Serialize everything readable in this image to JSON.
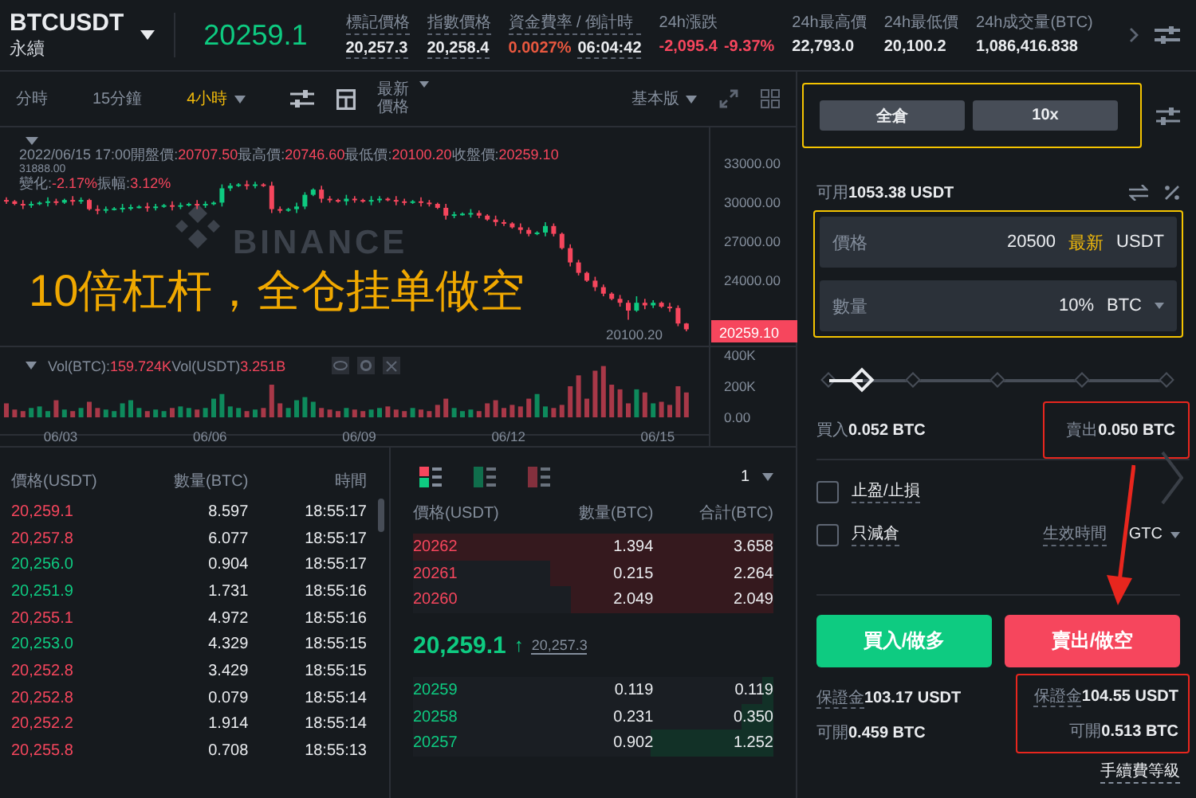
{
  "header": {
    "symbol": "BTCUSDT",
    "contract": "永續",
    "last_price": "20259.1",
    "stats": [
      {
        "label": "標記價格",
        "underlined": true,
        "values": [
          {
            "text": "20,257.3",
            "kind": "plain"
          }
        ]
      },
      {
        "label": "指數價格",
        "underlined": true,
        "values": [
          {
            "text": "20,258.4",
            "kind": "plain"
          }
        ]
      },
      {
        "label": "資金費率 / 倒計時",
        "underlined": true,
        "values": [
          {
            "text": "0.0027%",
            "kind": "rate"
          },
          {
            "text": "06:04:42",
            "kind": "plain"
          }
        ]
      },
      {
        "label": "24h漲跌",
        "underlined": false,
        "values": [
          {
            "text": "-2,095.4",
            "kind": "down"
          },
          {
            "text": "-9.37%",
            "kind": "down"
          }
        ]
      },
      {
        "label": "24h最高價",
        "underlined": false,
        "values": [
          {
            "text": "22,793.0",
            "kind": "plain"
          }
        ]
      },
      {
        "label": "24h最低價",
        "underlined": false,
        "values": [
          {
            "text": "20,100.2",
            "kind": "plain"
          }
        ]
      },
      {
        "label": "24h成交量(BTC)",
        "underlined": false,
        "values": [
          {
            "text": "1,086,416.838",
            "kind": "plain"
          }
        ]
      }
    ]
  },
  "toolbar": {
    "intervals": [
      {
        "label": "分時",
        "selected": false,
        "dropdown": false
      },
      {
        "label": "15分鐘",
        "selected": false,
        "dropdown": false
      },
      {
        "label": "4小時",
        "selected": true,
        "dropdown": true
      }
    ],
    "price_type": "最新價格",
    "view": "基本版"
  },
  "chart": {
    "logo_text": "BINANCE",
    "info_date": "2022/06/15 17:00",
    "info_line1": [
      {
        "label": "開盤價:",
        "value": "20707.50"
      },
      {
        "label": "最高價:",
        "value": "20746.60"
      },
      {
        "label": "最低價:",
        "value": "20100.20"
      },
      {
        "label": "收盤價:",
        "value": "20259.10"
      }
    ],
    "info_line2": [
      {
        "label": "變化:",
        "value": "-2.17%"
      },
      {
        "label": "振幅:",
        "value": "3.12%"
      }
    ],
    "max_label": "31888.00",
    "min_label": "20100.20",
    "price_tag": "20259.10",
    "date_labels": [
      "06/03",
      "06/06",
      "06/09",
      "06/12",
      "06/15"
    ],
    "chart_data": {
      "type": "candlestick",
      "ylim": [
        18882,
        35780
      ],
      "yticks": [
        {
          "value": 33000,
          "label": "33000.00"
        },
        {
          "value": 30000,
          "label": "30000.00"
        },
        {
          "value": 27000,
          "label": "27000.00"
        },
        {
          "value": 24000,
          "label": "24000.00"
        }
      ],
      "ohlc": [
        [
          30200,
          30400,
          29900,
          30100
        ],
        [
          30100,
          30200,
          29800,
          29900
        ],
        [
          29900,
          30200,
          29500,
          29800
        ],
        [
          29800,
          30100,
          29600,
          29900
        ],
        [
          29900,
          30100,
          29800,
          30000
        ],
        [
          30000,
          30400,
          29700,
          30100
        ],
        [
          30100,
          30300,
          29800,
          30000
        ],
        [
          30000,
          30300,
          29900,
          30200
        ],
        [
          30200,
          30500,
          29800,
          30100
        ],
        [
          30100,
          30400,
          29900,
          30200
        ],
        [
          30200,
          30300,
          29400,
          29500
        ],
        [
          29500,
          29800,
          29100,
          29400
        ],
        [
          29400,
          29700,
          29200,
          29500
        ],
        [
          29500,
          29650,
          29400,
          29550
        ],
        [
          29550,
          29900,
          29250,
          29600
        ],
        [
          29600,
          29850,
          29400,
          29650
        ],
        [
          29650,
          29800,
          29550,
          29700
        ],
        [
          29700,
          30000,
          29300,
          29600
        ],
        [
          29600,
          29900,
          29400,
          29700
        ],
        [
          29700,
          29900,
          29600,
          29800
        ],
        [
          29800,
          30100,
          29400,
          29700
        ],
        [
          29700,
          30000,
          29500,
          29800
        ],
        [
          29800,
          30000,
          29700,
          29900
        ],
        [
          29900,
          30200,
          29500,
          29800
        ],
        [
          29800,
          30100,
          29600,
          29900
        ],
        [
          29900,
          30100,
          29800,
          30000
        ],
        [
          30000,
          31400,
          29700,
          31100
        ],
        [
          31100,
          31500,
          30900,
          31300
        ],
        [
          31300,
          31500,
          31200,
          31400
        ],
        [
          31400,
          31700,
          31000,
          31300
        ],
        [
          31300,
          31600,
          31100,
          31400
        ],
        [
          31400,
          31500,
          31200,
          31300
        ],
        [
          31300,
          31600,
          29200,
          29500
        ],
        [
          29500,
          29700,
          29200,
          29400
        ],
        [
          29400,
          29600,
          29300,
          29500
        ],
        [
          29500,
          30000,
          29200,
          29700
        ],
        [
          29700,
          30800,
          29500,
          30600
        ],
        [
          30600,
          31100,
          30500,
          31000
        ],
        [
          31000,
          31300,
          30000,
          30300
        ],
        [
          30300,
          30500,
          30000,
          30200
        ],
        [
          30200,
          30300,
          30000,
          30100
        ],
        [
          30100,
          30600,
          29800,
          30300
        ],
        [
          30300,
          30500,
          30000,
          30200
        ],
        [
          30200,
          30300,
          30000,
          30100
        ],
        [
          30100,
          30500,
          29800,
          30200
        ],
        [
          30200,
          30500,
          30000,
          30300
        ],
        [
          30300,
          30400,
          30100,
          30200
        ],
        [
          30200,
          30500,
          29800,
          30100
        ],
        [
          30100,
          30300,
          29800,
          30000
        ],
        [
          30000,
          30200,
          29900,
          30100
        ],
        [
          30100,
          30400,
          29700,
          30000
        ],
        [
          30000,
          30200,
          29700,
          29900
        ],
        [
          29900,
          30000,
          29500,
          29600
        ],
        [
          29600,
          29900,
          28700,
          29000
        ],
        [
          29000,
          29300,
          28800,
          29100
        ],
        [
          29100,
          29250,
          29000,
          29150
        ],
        [
          29150,
          29500,
          28850,
          29200
        ],
        [
          29200,
          29400,
          28800,
          29000
        ],
        [
          29000,
          29100,
          28600,
          28700
        ],
        [
          28700,
          29000,
          28200,
          28500
        ],
        [
          28500,
          28700,
          28200,
          28400
        ],
        [
          28400,
          28500,
          28000,
          28100
        ],
        [
          28100,
          28400,
          27600,
          27900
        ],
        [
          27900,
          28100,
          27400,
          27600
        ],
        [
          27600,
          27800,
          27500,
          27700
        ],
        [
          27700,
          28500,
          27400,
          28200
        ],
        [
          28200,
          28400,
          27400,
          27600
        ],
        [
          27600,
          27700,
          26400,
          26500
        ],
        [
          26500,
          26800,
          25100,
          25400
        ],
        [
          25400,
          25600,
          24400,
          24600
        ],
        [
          24600,
          24700,
          23900,
          24000
        ],
        [
          24000,
          24300,
          23200,
          23500
        ],
        [
          23500,
          23700,
          22800,
          23000
        ],
        [
          23000,
          23100,
          22500,
          22600
        ],
        [
          22600,
          22900,
          22000,
          22300
        ],
        [
          22300,
          22500,
          21000,
          21700
        ],
        [
          21700,
          22800,
          21600,
          22300
        ],
        [
          22300,
          22600,
          21800,
          22100
        ],
        [
          22100,
          22500,
          21900,
          22300
        ],
        [
          22300,
          22400,
          21900,
          22000
        ],
        [
          22000,
          22300,
          21600,
          21900
        ],
        [
          21900,
          22100,
          20500,
          20707.5
        ],
        [
          20707.5,
          20746.6,
          20100.2,
          20259.1
        ]
      ]
    }
  },
  "volume": {
    "legend": [
      {
        "label": "Vol(BTC):",
        "value": "159.724K"
      },
      {
        "label": "Vol(USDT)",
        "value": "3.251B"
      }
    ],
    "chart_data": {
      "type": "bar",
      "ylim": [
        0,
        451000
      ],
      "yticks": [
        {
          "value": 400000,
          "label": "400K"
        },
        {
          "value": 200000,
          "label": "200K"
        },
        {
          "value": 0,
          "label": "0.00"
        }
      ],
      "series": [
        {
          "values": [
            90000,
            50000,
            40000,
            60000,
            70000,
            40000,
            110000,
            50000,
            40000,
            60000,
            100000,
            60000,
            50000,
            40000,
            90000,
            110000,
            60000,
            40000,
            50000,
            40000,
            60000,
            70000,
            60000,
            50000,
            60000,
            120000,
            150000,
            70000,
            60000,
            40000,
            50000,
            60000,
            210000,
            90000,
            60000,
            110000,
            130000,
            100000,
            60000,
            50000,
            40000,
            60000,
            50000,
            40000,
            50000,
            60000,
            70000,
            50000,
            40000,
            60000,
            50000,
            40000,
            80000,
            120000,
            60000,
            40000,
            50000,
            40000,
            90000,
            110000,
            60000,
            80000,
            70000,
            120000,
            150000,
            70000,
            60000,
            80000,
            200000,
            270000,
            120000,
            300000,
            330000,
            210000,
            180000,
            90000,
            180000,
            160000,
            90000,
            100000,
            80000,
            200000,
            160000
          ]
        }
      ]
    }
  },
  "annotation": {
    "text": "10倍杠杆，全仓挂单做空",
    "color": "#f0a800"
  },
  "trades": {
    "columns": [
      "價格(USDT)",
      "數量(BTC)",
      "時間"
    ],
    "rows": [
      {
        "price": "20,259.1",
        "amount": "8.597",
        "time": "18:55:17",
        "kind": "sell"
      },
      {
        "price": "20,257.8",
        "amount": "6.077",
        "time": "18:55:17",
        "kind": "sell"
      },
      {
        "price": "20,256.0",
        "amount": "0.904",
        "time": "18:55:17",
        "kind": "buy"
      },
      {
        "price": "20,251.9",
        "amount": "1.731",
        "time": "18:55:16",
        "kind": "buy"
      },
      {
        "price": "20,255.1",
        "amount": "4.972",
        "time": "18:55:16",
        "kind": "sell"
      },
      {
        "price": "20,253.0",
        "amount": "4.329",
        "time": "18:55:15",
        "kind": "buy"
      },
      {
        "price": "20,252.8",
        "amount": "3.429",
        "time": "18:55:15",
        "kind": "sell"
      },
      {
        "price": "20,252.8",
        "amount": "0.079",
        "time": "18:55:14",
        "kind": "sell"
      },
      {
        "price": "20,252.2",
        "amount": "1.914",
        "time": "18:55:14",
        "kind": "sell"
      },
      {
        "price": "20,255.8",
        "amount": "0.708",
        "time": "18:55:13",
        "kind": "sell"
      }
    ]
  },
  "order_book": {
    "view_modes": [
      {
        "kind": "both",
        "selected": true
      },
      {
        "kind": "bids",
        "selected": false
      },
      {
        "kind": "asks",
        "selected": false
      }
    ],
    "precision": "1",
    "columns": [
      "價格(USDT)",
      "數量(BTC)",
      "合計(BTC)"
    ],
    "asks": [
      {
        "price": "20262",
        "amount": "1.394",
        "total": "3.658",
        "level": 1.0
      },
      {
        "price": "20261",
        "amount": "0.215",
        "total": "2.264",
        "level": 0.62
      },
      {
        "price": "20260",
        "amount": "2.049",
        "total": "2.049",
        "level": 0.56
      }
    ],
    "mid": {
      "price": "20,259.1",
      "arrow": "↑",
      "mark_price": "20,257.3"
    },
    "bids": [
      {
        "price": "20259",
        "amount": "0.119",
        "total": "0.119",
        "level": 0.03
      },
      {
        "price": "20258",
        "amount": "0.231",
        "total": "0.350",
        "level": 0.09
      },
      {
        "price": "20257",
        "amount": "0.902",
        "total": "1.252",
        "level": 0.34
      }
    ]
  },
  "order": {
    "margin_mode": {
      "mode": "全倉",
      "leverage": "10x",
      "highlight": {
        "color": "#f5c400"
      }
    },
    "available": {
      "label": "可用",
      "value": "1053.38 USDT"
    },
    "fields": {
      "highlight": {
        "color": "#f5c400"
      },
      "price": {
        "label": "價格",
        "value": "20500",
        "tag": "最新",
        "unit": "USDT"
      },
      "quantity": {
        "label": "數量",
        "value": "10%",
        "unit": "BTC"
      }
    },
    "slider": {
      "level": 0.1
    },
    "buy_amount": {
      "label": "買入",
      "value": "0.052 BTC"
    },
    "sell_amount": {
      "label": "賣出",
      "value": "0.050 BTC",
      "highlight": {
        "color": "#e8261e"
      }
    },
    "options": [
      {
        "label": "止盈/止損",
        "checked": false
      },
      {
        "label": "只減倉",
        "checked": false
      }
    ],
    "time_in_force": {
      "label": "生效時間",
      "value": "GTC"
    },
    "buttons": [
      {
        "label": "買入/做多",
        "kind": "buy"
      },
      {
        "label": "賣出/做空",
        "kind": "sell"
      }
    ],
    "buy_info": [
      {
        "label": "保證金",
        "value": "103.17 USDT"
      },
      {
        "label": "可開",
        "value": "0.459 BTC"
      }
    ],
    "sell_info": {
      "highlight": {
        "color": "#e8261e"
      },
      "rows": [
        {
          "label": "保證金",
          "value": "104.55 USDT"
        },
        {
          "label": "可開",
          "value": "0.513 BTC"
        }
      ]
    },
    "fee_level": "手續費等級",
    "arrow": {
      "color": "#e8261e"
    }
  }
}
